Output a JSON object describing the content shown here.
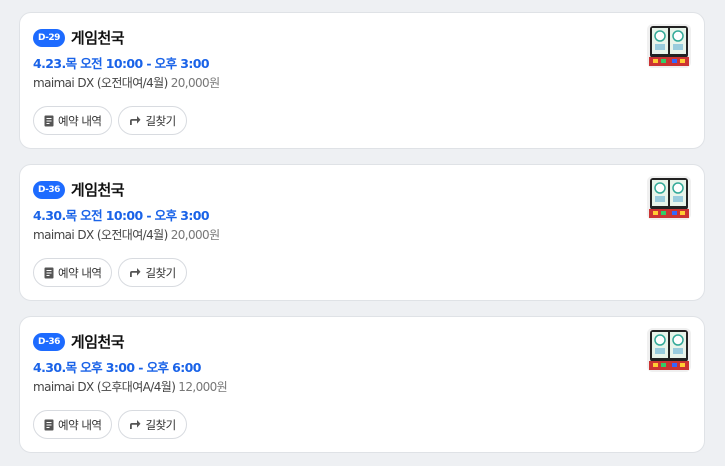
{
  "reservations": [
    {
      "dday": "D-29",
      "place": "게임천국",
      "datetime": "4.23.목 오전 10:00 - 오후 3:00",
      "description": "maimai DX (오전대여/4월)",
      "price": "20,000원",
      "buttons": {
        "reservation": "예약 내역",
        "directions": "길찾기"
      },
      "thumbnail_icon": "arcade-machine-image"
    },
    {
      "dday": "D-36",
      "place": "게임천국",
      "datetime": "4.30.목 오전 10:00 - 오후 3:00",
      "description": "maimai DX (오전대여/4월)",
      "price": "20,000원",
      "buttons": {
        "reservation": "예약 내역",
        "directions": "길찾기"
      },
      "thumbnail_icon": "arcade-machine-image"
    },
    {
      "dday": "D-36",
      "place": "게임천국",
      "datetime": "4.30.목 오후 3:00 - 오후 6:00",
      "description": "maimai DX (오후대여A/4월)",
      "price": "12,000원",
      "buttons": {
        "reservation": "예약 내역",
        "directions": "길찾기"
      },
      "thumbnail_icon": "arcade-machine-image"
    }
  ],
  "colors": {
    "accent": "#1d6bff",
    "datetime": "#1a63e8",
    "background": "#eef0f3",
    "card": "#ffffff"
  }
}
